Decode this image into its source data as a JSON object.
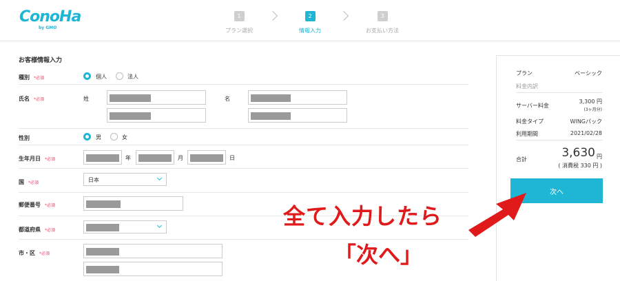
{
  "brand": {
    "logo": "ConoHa",
    "logo_sub": "by GMO"
  },
  "steps": [
    {
      "num": "1",
      "label": "プラン選択"
    },
    {
      "num": "2",
      "label": "情報入力"
    },
    {
      "num": "3",
      "label": "お支払い方法"
    }
  ],
  "form": {
    "section_title": "お客様情報入力",
    "required": "*必須",
    "kind": {
      "label": "種別",
      "options": [
        "個人",
        "法人"
      ],
      "selected": "個人"
    },
    "name": {
      "label": "氏名",
      "last": "姓",
      "first": "名"
    },
    "gender": {
      "label": "性別",
      "options": [
        "男",
        "女"
      ],
      "selected": "男"
    },
    "birth": {
      "label": "生年月日",
      "year": "年",
      "month": "月",
      "day": "日"
    },
    "country": {
      "label": "国",
      "value": "日本"
    },
    "postal": {
      "label": "郵便番号"
    },
    "prefecture": {
      "label": "都道府県"
    },
    "city": {
      "label": "市・区"
    }
  },
  "summary": {
    "plan_label": "プラン",
    "plan_value": "ベーシック",
    "breakdown_label": "料金内訳",
    "server_label": "サーバー料金",
    "server_value": "3,300 円",
    "server_period": "(3ヶ月分)",
    "type_label": "料金タイプ",
    "type_value": "WINGパック",
    "term_label": "利用期間",
    "term_value": "2021/02/28",
    "total_label": "合計",
    "total_value": "3,630",
    "total_unit": "円",
    "tax": "( 消費税 330 円 )",
    "next_label": "次へ"
  },
  "annotation": {
    "line1": "全て入力したら",
    "line2": "「次へ」"
  },
  "colors": {
    "accent": "#1fb6d6",
    "annotation": "#e01a1a",
    "required": "#e04b6a"
  }
}
